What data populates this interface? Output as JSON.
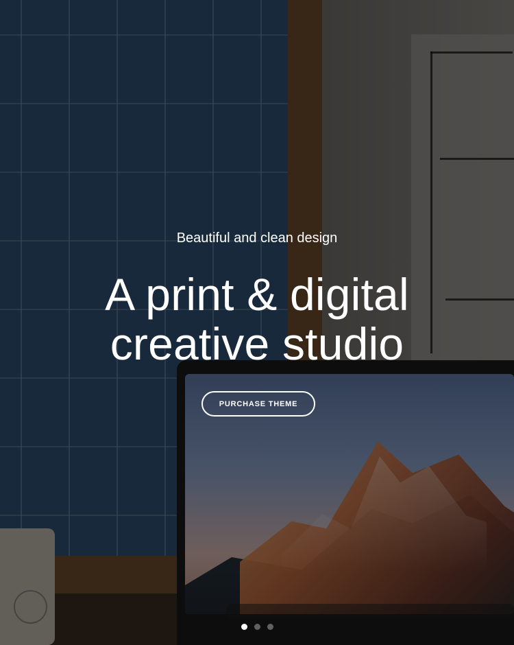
{
  "hero": {
    "eyebrow": "Beautiful and clean design",
    "headline_line1": "A print & digital",
    "headline_line2": "creative studio",
    "cta_label": "PURCHASE THEME"
  },
  "slider": {
    "active_index": 0,
    "dots_count": 3
  },
  "colors": {
    "overlay": "rgba(0,0,0,0.48)",
    "text": "#ffffff",
    "poster_blue": "#2f4f73",
    "frame_brown": "#6b4a2b"
  },
  "icons": {
    "slider_dot": "dot-icon"
  }
}
